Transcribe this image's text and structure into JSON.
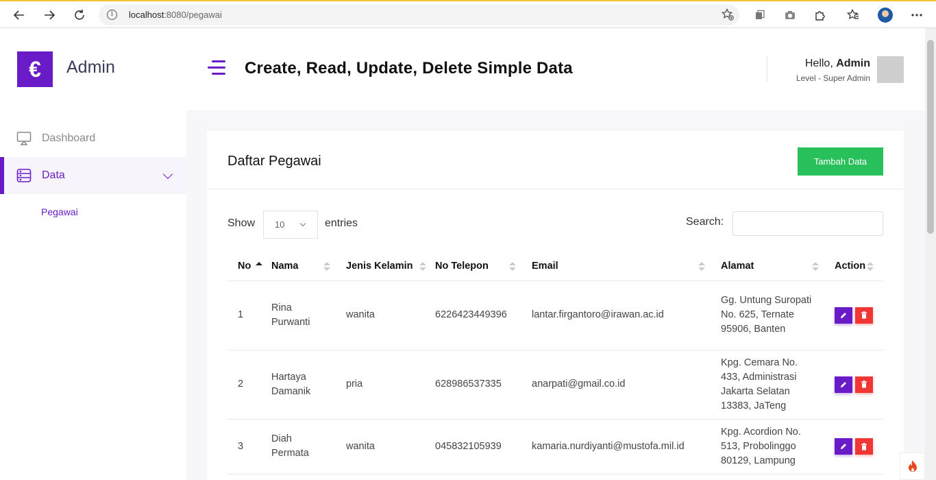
{
  "browser": {
    "url_host": "localhost",
    "url_path": ":8080/pegawai"
  },
  "sidebar": {
    "logo_glyph": "€",
    "brand": "Admin",
    "items": [
      {
        "label": "Dashboard",
        "icon": "monitor-icon"
      },
      {
        "label": "Data",
        "icon": "database-icon",
        "active": true
      }
    ],
    "sub_items": [
      {
        "label": "Pegawai"
      }
    ]
  },
  "header": {
    "title": "Create, Read, Update, Delete Simple Data",
    "greeting": "Hello, ",
    "user": "Admin",
    "level": "Level - Super Admin"
  },
  "card": {
    "title": "Daftar Pegawai",
    "add_button": "Tambah Data",
    "show_label": "Show",
    "entries_value": "10",
    "entries_label": "entries",
    "search_label": "Search:",
    "search_value": ""
  },
  "table": {
    "columns": [
      "No",
      "Nama",
      "Jenis Kelamin",
      "No Telepon",
      "Email",
      "Alamat",
      "Action"
    ],
    "rows": [
      {
        "no": "1",
        "nama": "Rina Purwanti",
        "jk": "wanita",
        "telp": "6226423449396",
        "email": "lantar.firgantoro@irawan.ac.id",
        "alamat": "Gg. Untung Suropati No. 625, Ternate 95906, Banten"
      },
      {
        "no": "2",
        "nama": "Hartaya Damanik",
        "jk": "pria",
        "telp": "628986537335",
        "email": "anarpati@gmail.co.id",
        "alamat": "Kpg. Cemara No. 433, Administrasi Jakarta Selatan 13383, JaTeng"
      },
      {
        "no": "3",
        "nama": "Diah Permata",
        "jk": "wanita",
        "telp": "045832105939",
        "email": "kamaria.nurdiyanti@mustofa.mil.id",
        "alamat": "Kpg. Acordion No. 513, Probolinggo 80129, Lampung"
      }
    ]
  },
  "colors": {
    "accent": "#6a1bc8",
    "success": "#28c05a",
    "danger": "#f13636"
  }
}
